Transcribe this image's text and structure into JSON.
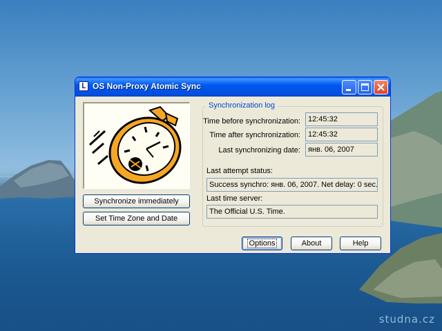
{
  "window": {
    "title": "OS Non-Proxy Atomic Sync"
  },
  "buttons": {
    "sync": "Synchronize immediately",
    "timezone": "Set Time Zone and Date",
    "options": "Options",
    "about": "About",
    "help": "Help"
  },
  "log": {
    "group_title": "Synchronization  log",
    "time_before_label": "Time before synchronization:",
    "time_before_value": "12:45:32",
    "time_after_label": "Time after synchronization:",
    "time_after_value": "12:45:32",
    "last_date_label": "Last synchronizing date:",
    "last_date_value": "янв. 06, 2007",
    "attempt_label": "Last attempt status:",
    "attempt_value": "Success synchro: янв. 06, 2007. Net delay: 0 sec.",
    "server_label": "Last time server:",
    "server_value": "The Official U.S. Time."
  },
  "watermark": "studna.cz"
}
